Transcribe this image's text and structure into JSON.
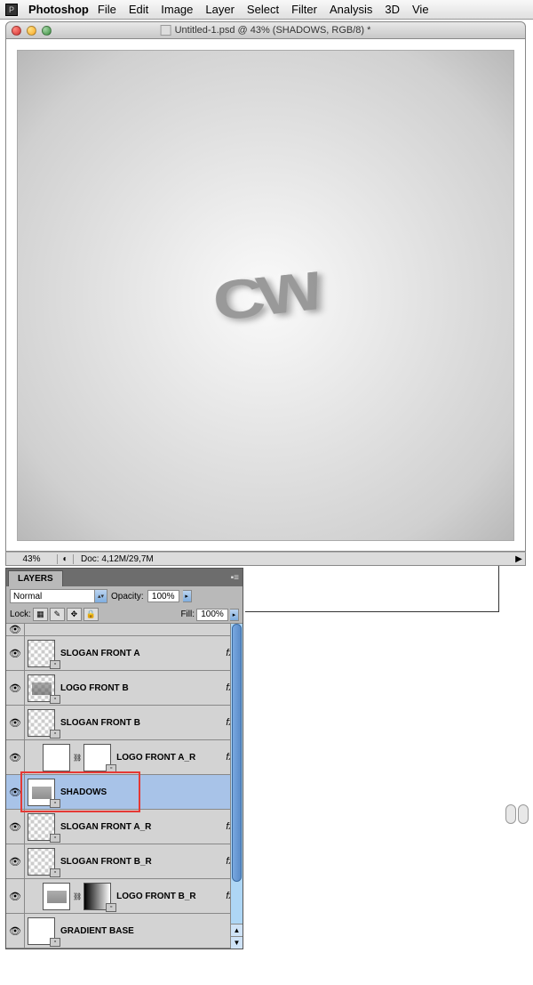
{
  "menubar": {
    "app": "Photoshop",
    "items": [
      "File",
      "Edit",
      "Image",
      "Layer",
      "Select",
      "Filter",
      "Analysis",
      "3D",
      "Vie"
    ]
  },
  "window": {
    "title": "Untitled-1.psd @ 43% (SHADOWS, RGB/8) *"
  },
  "status": {
    "zoom": "43%",
    "doc": "Doc: 4,12M/29,7M"
  },
  "panel": {
    "tab": "LAYERS",
    "blend_mode": "Normal",
    "opacity_label": "Opacity:",
    "opacity_value": "100%",
    "lock_label": "Lock:",
    "fill_label": "Fill:",
    "fill_value": "100%"
  },
  "layers": [
    {
      "name": "SLOGAN FRONT A",
      "fx": true,
      "mask": false,
      "thumb": "checker"
    },
    {
      "name": "LOGO FRONT B",
      "fx": true,
      "mask": false,
      "thumb": "checker-art"
    },
    {
      "name": "SLOGAN FRONT B",
      "fx": true,
      "mask": false,
      "thumb": "checker"
    },
    {
      "name": "LOGO FRONT A_R",
      "fx": true,
      "mask": true,
      "thumb": "white",
      "indent": true
    },
    {
      "name": "SHADOWS",
      "fx": false,
      "mask": false,
      "selected": true,
      "thumb": "white-art"
    },
    {
      "name": "SLOGAN FRONT A_R",
      "fx": true,
      "mask": false,
      "thumb": "checker"
    },
    {
      "name": "SLOGAN FRONT B_R",
      "fx": true,
      "mask": false,
      "thumb": "checker"
    },
    {
      "name": "LOGO FRONT B_R",
      "fx": true,
      "mask": true,
      "thumb": "white-grad",
      "indent": true
    },
    {
      "name": "GRADIENT BASE",
      "fx": false,
      "mask": false,
      "thumb": "white-plain"
    }
  ],
  "fx_label": "fx"
}
